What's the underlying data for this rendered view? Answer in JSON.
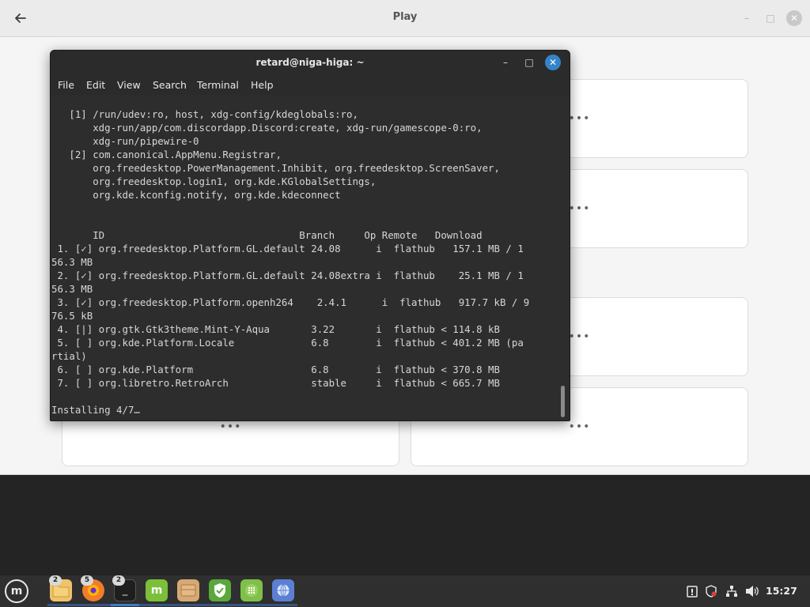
{
  "background_window": {
    "title": "Play",
    "back_icon": "arrow-left-icon",
    "card_more_label": "•••"
  },
  "terminal": {
    "title": "retard@niga-higa: ~",
    "menu": [
      "File",
      "Edit",
      "View",
      "Search",
      "Terminal",
      "Help"
    ],
    "content": "   [1] /run/udev:ro, host, xdg-config/kdeglobals:ro,\n       xdg-run/app/com.discordapp.Discord:create, xdg-run/gamescope-0:ro,\n       xdg-run/pipewire-0\n   [2] com.canonical.AppMenu.Registrar,\n       org.freedesktop.PowerManagement.Inhibit, org.freedesktop.ScreenSaver,\n       org.freedesktop.login1, org.kde.KGlobalSettings,\n       org.kde.kconfig.notify, org.kde.kdeconnect\n\n\n       ID                                 Branch     Op Remote   Download\n 1. [✓] org.freedesktop.Platform.GL.default 24.08      i  flathub   157.1 MB / 1\n56.3 MB\n 2. [✓] org.freedesktop.Platform.GL.default 24.08extra i  flathub    25.1 MB / 1\n56.3 MB\n 3. [✓] org.freedesktop.Platform.openh264    2.4.1      i  flathub   917.7 kB / 9\n76.5 kB\n 4. [|] org.gtk.Gtk3theme.Mint-Y-Aqua       3.22       i  flathub < 114.8 kB\n 5. [ ] org.kde.Platform.Locale             6.8        i  flathub < 401.2 MB (pa\nrtial)\n 6. [ ] org.kde.Platform                    6.8        i  flathub < 370.8 MB\n 7. [ ] org.libretro.RetroArch              stable     i  flathub < 665.7 MB\n\nInstalling 4/7…"
  },
  "taskbar": {
    "menu_icon": "mint-menu-icon",
    "apps": [
      {
        "name": "files",
        "icon": "folder-icon",
        "badge": "2",
        "color": "#f0c36a"
      },
      {
        "name": "firefox",
        "icon": "firefox-icon",
        "badge": "5",
        "color": "#f07d2a"
      },
      {
        "name": "terminal",
        "icon": "terminal-icon",
        "badge": "2",
        "color": "#1e1e1e"
      },
      {
        "name": "mintinstall",
        "icon": "mint-icon",
        "badge": "",
        "color": "#7bbf3a"
      },
      {
        "name": "archive",
        "icon": "archive-icon",
        "badge": "",
        "color": "#d7a972"
      },
      {
        "name": "shield",
        "icon": "shield-icon",
        "badge": "",
        "color": "#5aa83c"
      },
      {
        "name": "calculator",
        "icon": "grid-icon",
        "badge": "",
        "color": "#7ec04a"
      },
      {
        "name": "web",
        "icon": "globe-icon",
        "badge": "",
        "color": "#5b7fd3"
      }
    ],
    "clock": "15:27"
  }
}
